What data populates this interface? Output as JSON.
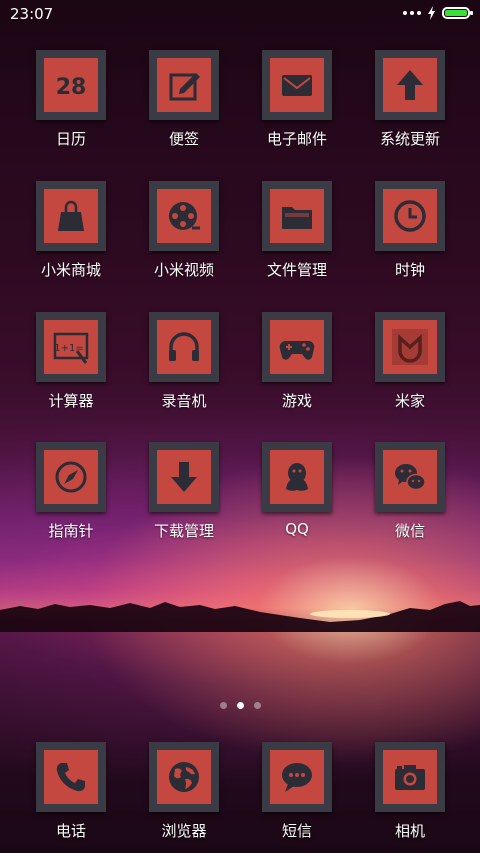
{
  "status_bar": {
    "time": "23:07",
    "battery_level": 1.0,
    "charging": true,
    "battery_color": "#3ae03a"
  },
  "colors": {
    "tile_frame": "#3a3b45",
    "tile_face": "#c4483f",
    "icon_glyph": "#2b2c36"
  },
  "apps": [
    {
      "label": "日历",
      "icon": "calendar-icon",
      "glyph_text": "28"
    },
    {
      "label": "便签",
      "icon": "notes-icon"
    },
    {
      "label": "电子邮件",
      "icon": "mail-icon"
    },
    {
      "label": "系统更新",
      "icon": "update-arrow-icon"
    },
    {
      "label": "小米商城",
      "icon": "shopping-bag-icon"
    },
    {
      "label": "小米视频",
      "icon": "film-reel-icon"
    },
    {
      "label": "文件管理",
      "icon": "folder-icon"
    },
    {
      "label": "时钟",
      "icon": "clock-icon"
    },
    {
      "label": "计算器",
      "icon": "calculator-icon",
      "glyph_text": "1+1="
    },
    {
      "label": "录音机",
      "icon": "headphones-icon"
    },
    {
      "label": "游戏",
      "icon": "gamepad-icon"
    },
    {
      "label": "米家",
      "icon": "mijia-icon"
    },
    {
      "label": "指南针",
      "icon": "compass-icon"
    },
    {
      "label": "下载管理",
      "icon": "download-arrow-icon"
    },
    {
      "label": "QQ",
      "icon": "qq-penguin-icon"
    },
    {
      "label": "微信",
      "icon": "wechat-icon"
    }
  ],
  "pager": {
    "pages": 3,
    "current": 2
  },
  "dock": [
    {
      "label": "电话",
      "icon": "phone-icon"
    },
    {
      "label": "浏览器",
      "icon": "globe-icon"
    },
    {
      "label": "短信",
      "icon": "message-bubble-icon"
    },
    {
      "label": "相机",
      "icon": "camera-icon"
    }
  ]
}
